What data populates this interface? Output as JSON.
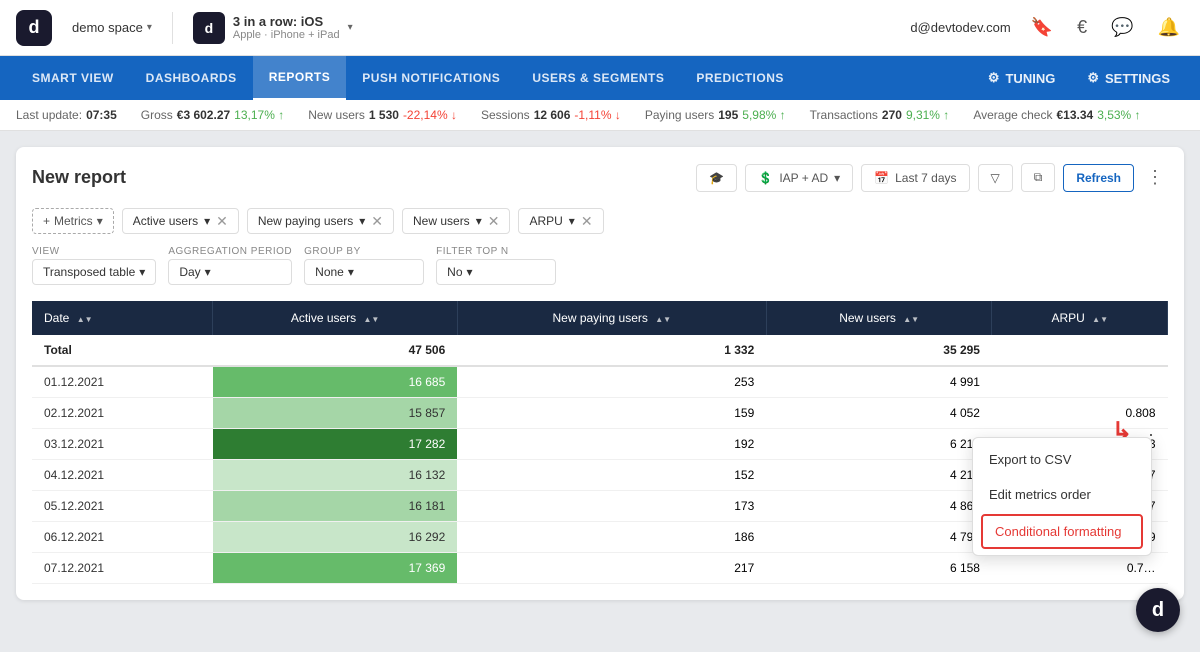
{
  "topbar": {
    "logo_letter": "d",
    "workspace": "demo space",
    "workspace_chevron": "▾",
    "app_logo_letter": "d",
    "app_name": "3 in a row: iOS",
    "app_platform": "Apple · iPhone + iPad",
    "app_chevron": "▾",
    "user_email": "d@devtodev.com"
  },
  "nav": {
    "items": [
      {
        "label": "SMART VIEW",
        "active": false
      },
      {
        "label": "DASHBOARDS",
        "active": false
      },
      {
        "label": "REPORTS",
        "active": true
      },
      {
        "label": "PUSH NOTIFICATIONS",
        "active": false
      },
      {
        "label": "USERS & SEGMENTS",
        "active": false
      },
      {
        "label": "PREDICTIONS",
        "active": false
      }
    ],
    "tuning_label": "TUNING",
    "settings_label": "SETTINGS"
  },
  "stats": [
    {
      "label": "Last update:",
      "value": "07:35",
      "change": "",
      "direction": ""
    },
    {
      "label": "Gross",
      "value": "€3 602.27",
      "change": "13,17%",
      "direction": "up"
    },
    {
      "label": "New users",
      "value": "1 530",
      "change": "-22,14%",
      "direction": "down"
    },
    {
      "label": "Sessions",
      "value": "12 606",
      "change": "-1,11%",
      "direction": "down"
    },
    {
      "label": "Paying users",
      "value": "195",
      "change": "5,98%",
      "direction": "up"
    },
    {
      "label": "Transactions",
      "value": "270",
      "change": "9,31%",
      "direction": "up"
    },
    {
      "label": "Average check",
      "value": "€13.34",
      "change": "3,53%",
      "direction": "up"
    }
  ],
  "report": {
    "title": "New report",
    "actions": {
      "filter_label": "🔽",
      "copy_label": "⧉",
      "refresh_label": "Refresh",
      "date_range_label": "Last 7 days",
      "iap_label": "IAP + AD",
      "more_label": "⋮"
    }
  },
  "metrics": [
    {
      "label": "Metrics",
      "is_add": true
    },
    {
      "label": "Active users",
      "closeable": true
    },
    {
      "label": "New paying users",
      "closeable": true
    },
    {
      "label": "New users",
      "closeable": true
    },
    {
      "label": "ARPU",
      "closeable": true
    }
  ],
  "controls": {
    "view_label": "View",
    "view_value": "Transposed table",
    "aggregation_label": "Aggregation period",
    "aggregation_value": "Day",
    "group_label": "Group by",
    "group_value": "None",
    "filter_label": "Filter Top N",
    "filter_value": "No"
  },
  "table": {
    "headers": [
      "Date",
      "Active users",
      "New paying users",
      "New users",
      "ARPU"
    ],
    "total_row": {
      "date": "Total",
      "active_users": "47 506",
      "new_paying": "1 332",
      "new_users": "35 295",
      "arpu": ""
    },
    "rows": [
      {
        "date": "01.12.2021",
        "active_users": "16 685",
        "new_paying": "253",
        "new_users": "4 991",
        "arpu": "",
        "shade": "green-medium"
      },
      {
        "date": "02.12.2021",
        "active_users": "15 857",
        "new_paying": "159",
        "new_users": "4 052",
        "arpu": "0.808",
        "shade": "green-light"
      },
      {
        "date": "03.12.2021",
        "active_users": "17 282",
        "new_paying": "192",
        "new_users": "6 213",
        "arpu": "0.773",
        "shade": "green-dark"
      },
      {
        "date": "04.12.2021",
        "active_users": "16 132",
        "new_paying": "152",
        "new_users": "4 219",
        "arpu": "0.727",
        "shade": "green-lighter"
      },
      {
        "date": "05.12.2021",
        "active_users": "16 181",
        "new_paying": "173",
        "new_users": "4 867",
        "arpu": "0.757",
        "shade": "green-light"
      },
      {
        "date": "06.12.2021",
        "active_users": "16 292",
        "new_paying": "186",
        "new_users": "4 795",
        "arpu": "0.749",
        "shade": "green-lighter"
      },
      {
        "date": "07.12.2021",
        "active_users": "17 369",
        "new_paying": "217",
        "new_users": "6 158",
        "arpu": "0.7…",
        "shade": "green-medium"
      }
    ]
  },
  "context_menu": {
    "items": [
      {
        "label": "Export to CSV",
        "highlighted": false
      },
      {
        "label": "Edit metrics order",
        "highlighted": false
      },
      {
        "label": "Conditional formatting",
        "highlighted": true
      }
    ]
  },
  "watermark": {
    "letter": "d"
  }
}
